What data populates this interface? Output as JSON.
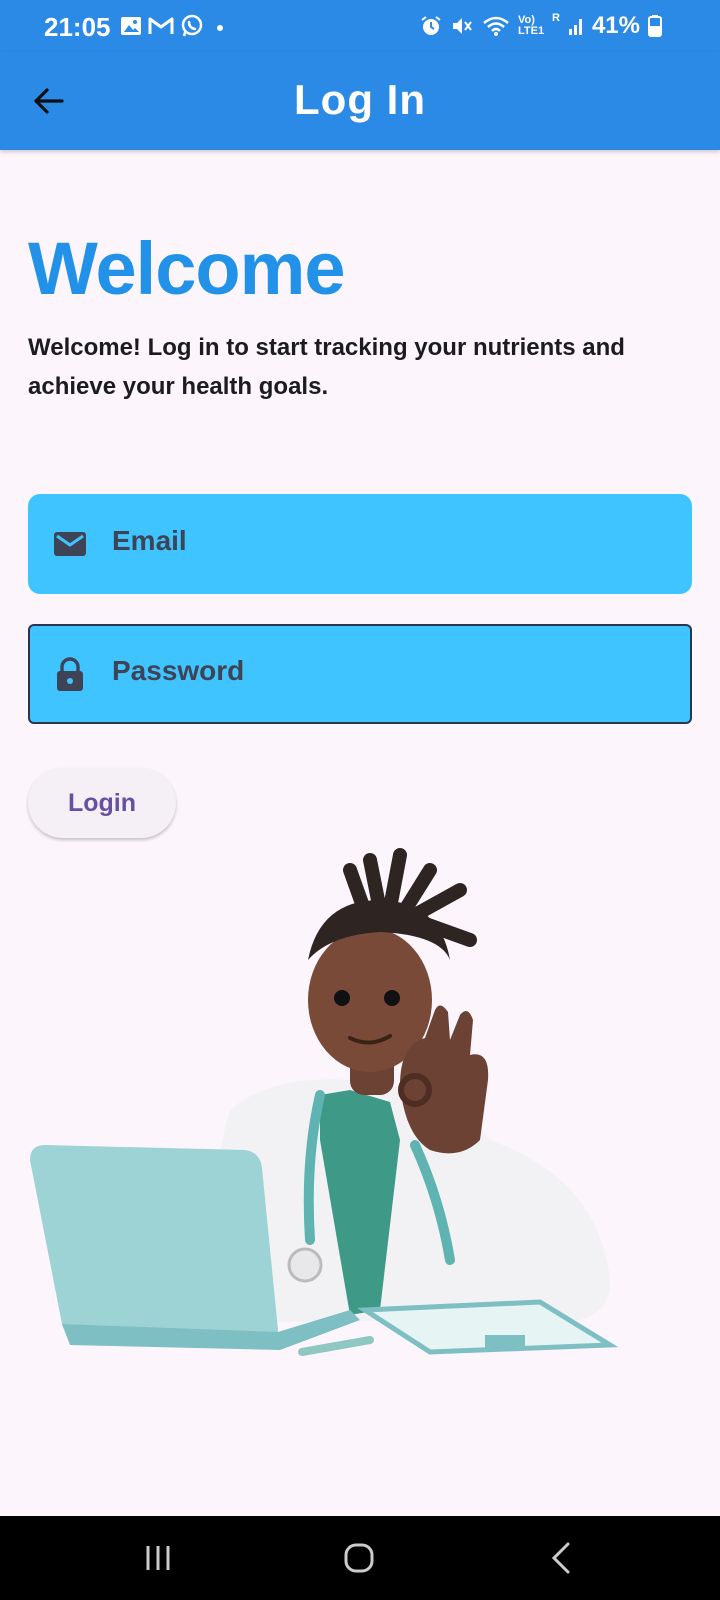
{
  "status_bar": {
    "time": "21:05",
    "battery": "41%",
    "left_icons": [
      "gallery-icon",
      "gmail-icon",
      "whatsapp-icon",
      "dot-icon"
    ],
    "right_icons": [
      "alarm-icon",
      "mute-icon",
      "wifi-icon",
      "volte-icon",
      "signal-icon",
      "battery-icon"
    ],
    "volte_label": "Vo) LTE1",
    "roaming_label": "R"
  },
  "app_bar": {
    "title": "Log In",
    "back_icon": "arrow-left-icon"
  },
  "content": {
    "heading": "Welcome",
    "subtitle": "Welcome! Log in to start tracking your nutrients and achieve your health goals.",
    "email": {
      "placeholder": "Email",
      "icon": "mail-icon"
    },
    "password": {
      "placeholder": "Password",
      "icon": "lock-icon"
    },
    "login_label": "Login",
    "illustration": "doctor-with-laptop-illustration"
  },
  "colors": {
    "primary": "#2b8ae6",
    "heading": "#2291e8",
    "field_fill": "#40c4ff",
    "button_text": "#6750a4",
    "background": "#fcf5fc"
  },
  "nav_bar": {
    "buttons": [
      "recents-icon",
      "home-icon",
      "back-icon"
    ]
  }
}
